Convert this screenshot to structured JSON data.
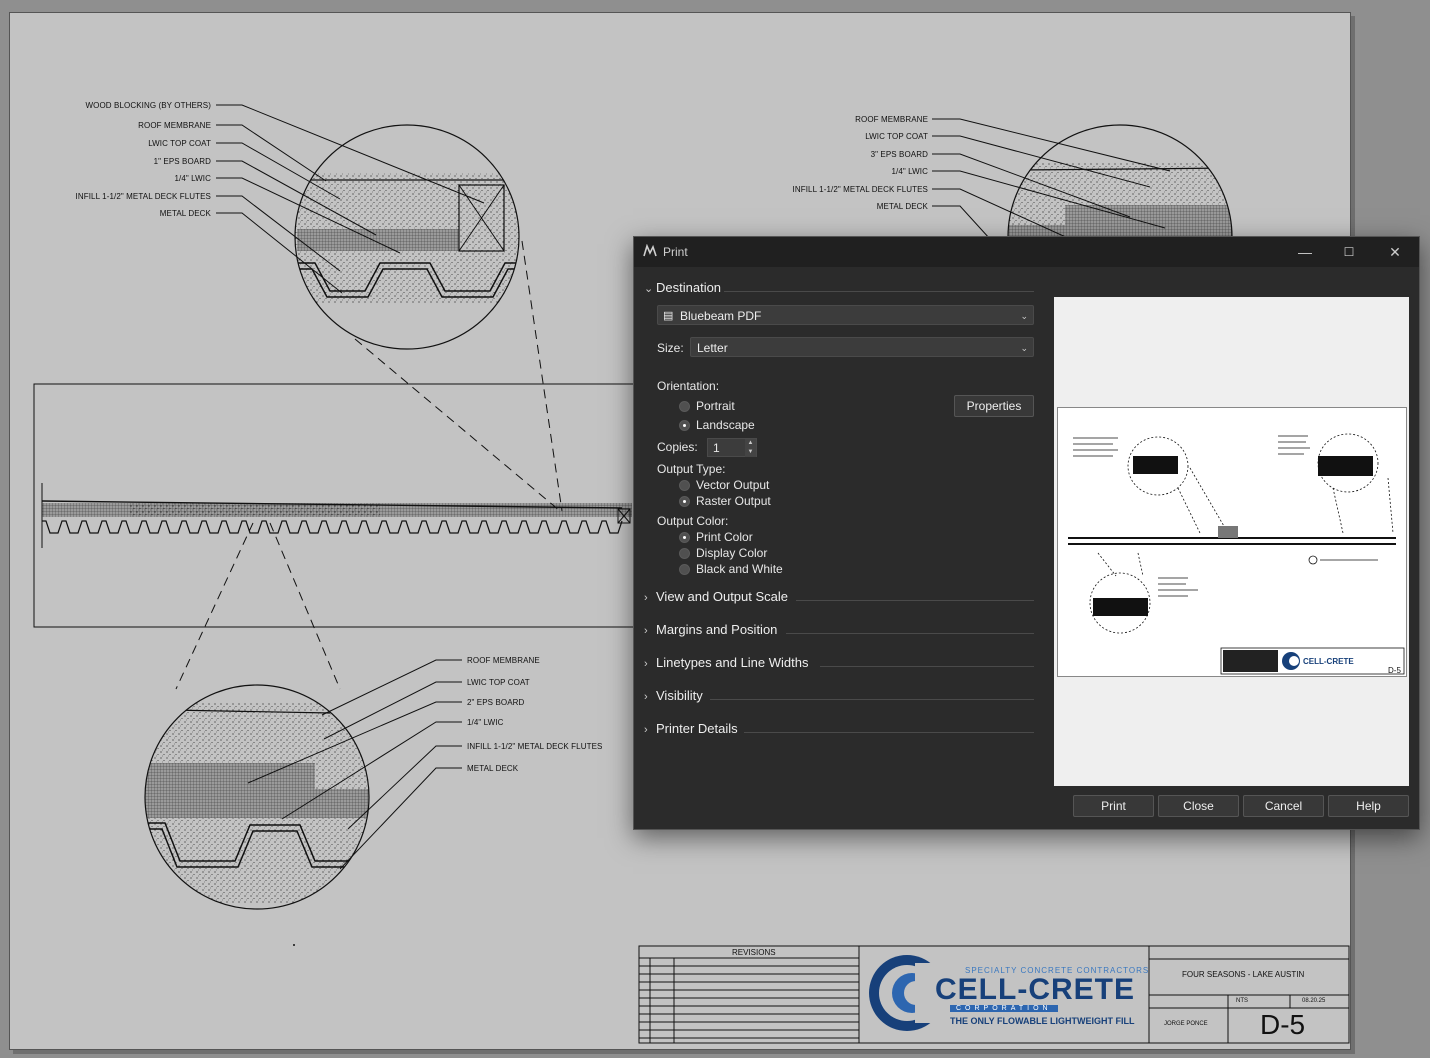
{
  "drawing": {
    "detail_top_left": {
      "labels": [
        "WOOD BLOCKING (BY OTHERS)",
        "ROOF MEMBRANE",
        "LWIC TOP COAT",
        "1\" EPS BOARD",
        "1/4\" LWIC",
        "INFILL 1-1/2\" METAL DECK FLUTES",
        "METAL DECK"
      ]
    },
    "detail_top_right": {
      "labels": [
        "ROOF MEMBRANE",
        "LWIC TOP COAT",
        "3\" EPS BOARD",
        "1/4\" LWIC",
        "INFILL 1-1/2\" METAL DECK FLUTES",
        "METAL DECK"
      ]
    },
    "detail_bottom": {
      "labels": [
        "ROOF MEMBRANE",
        "LWIC TOP COAT",
        "2\" EPS BOARD",
        "1/4\" LWIC",
        "INFILL 1-1/2\" METAL DECK FLUTES",
        "METAL DECK"
      ]
    },
    "title_block": {
      "revisions_label": "REVISIONS",
      "logo_tagline_top": "SPECIALTY CONCRETE CONTRACTORS",
      "logo_name": "CELL-CRETE",
      "logo_corp": "CORPORATION",
      "logo_tagline_bottom": "THE ONLY FLOWABLE LIGHTWEIGHT FILL",
      "project": "FOUR SEASONS - LAKE AUSTIN",
      "scale": "NTS",
      "date": "08.20.25",
      "drawn_by": "JORGE PONCE",
      "sheet_number": "D-5"
    }
  },
  "print_dialog": {
    "title": "Print",
    "window_controls": {
      "minimize": "—",
      "maximize": "☐",
      "close": "✕"
    },
    "destination": {
      "header": "Destination",
      "printer": "Bluebeam PDF",
      "size_label": "Size:",
      "size_value": "Letter",
      "orientation_label": "Orientation:",
      "orientation_options": [
        "Portrait",
        "Landscape"
      ],
      "orientation_selected": "Landscape",
      "properties_button": "Properties",
      "copies_label": "Copies:",
      "copies_value": "1",
      "output_type_label": "Output Type:",
      "output_type_options": [
        "Vector Output",
        "Raster Output"
      ],
      "output_type_selected": "Raster Output",
      "output_color_label": "Output Color:",
      "output_color_options": [
        "Print Color",
        "Display Color",
        "Black and White"
      ],
      "output_color_selected": "Print Color"
    },
    "collapsed_sections": [
      "View and Output Scale",
      "Margins and Position",
      "Linetypes and Line Widths",
      "Visibility",
      "Printer Details"
    ],
    "buttons": {
      "print": "Print",
      "close": "Close",
      "cancel": "Cancel",
      "help": "Help"
    },
    "preview_sheet_number": "D-5"
  }
}
